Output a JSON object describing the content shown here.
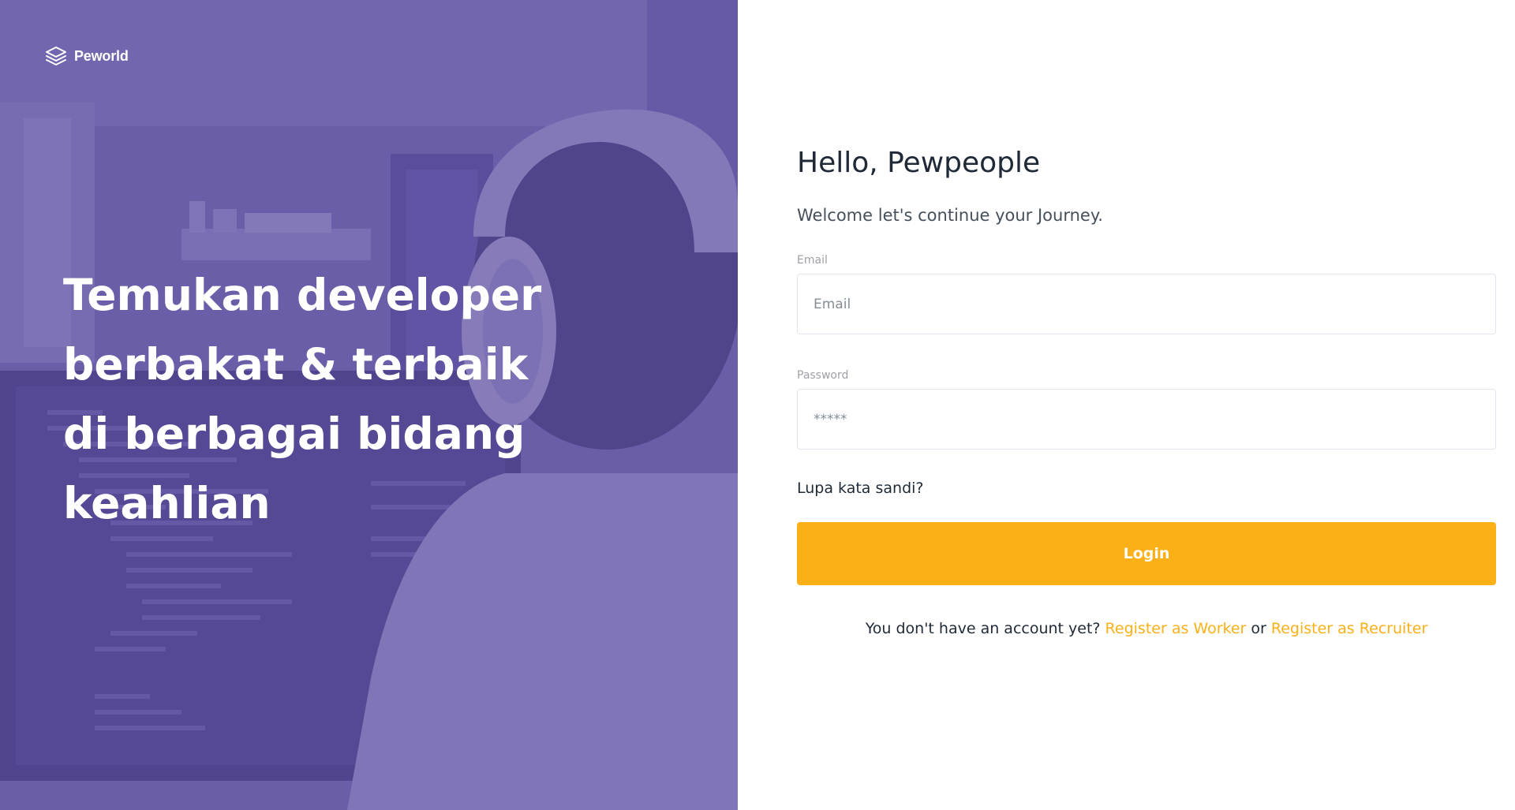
{
  "brand": {
    "name": "Peworld",
    "logo_icon": "layers-icon"
  },
  "hero": {
    "headline": "Temukan developer berbakat & terbaik di berbagai bidang keahlian",
    "background_image": "developer-with-headphones-at-monitor",
    "overlay_color": "#5E50A1"
  },
  "login": {
    "title": "Hello, Pewpeople",
    "subtitle": "Welcome let's continue your Journey.",
    "email": {
      "label": "Email",
      "placeholder": "Email",
      "value": ""
    },
    "password": {
      "label": "Password",
      "placeholder": "*****",
      "value": ""
    },
    "forgot_link": "Lupa kata sandi?",
    "button_label": "Login",
    "register": {
      "prefix": "You don't have an account yet?",
      "worker_link": "Register as Worker",
      "connector": "or",
      "recruiter_link": "Register as Recruiter"
    }
  },
  "colors": {
    "accent": "#FBB017",
    "primary": "#5E50A1",
    "heading_text": "#1F2937"
  }
}
